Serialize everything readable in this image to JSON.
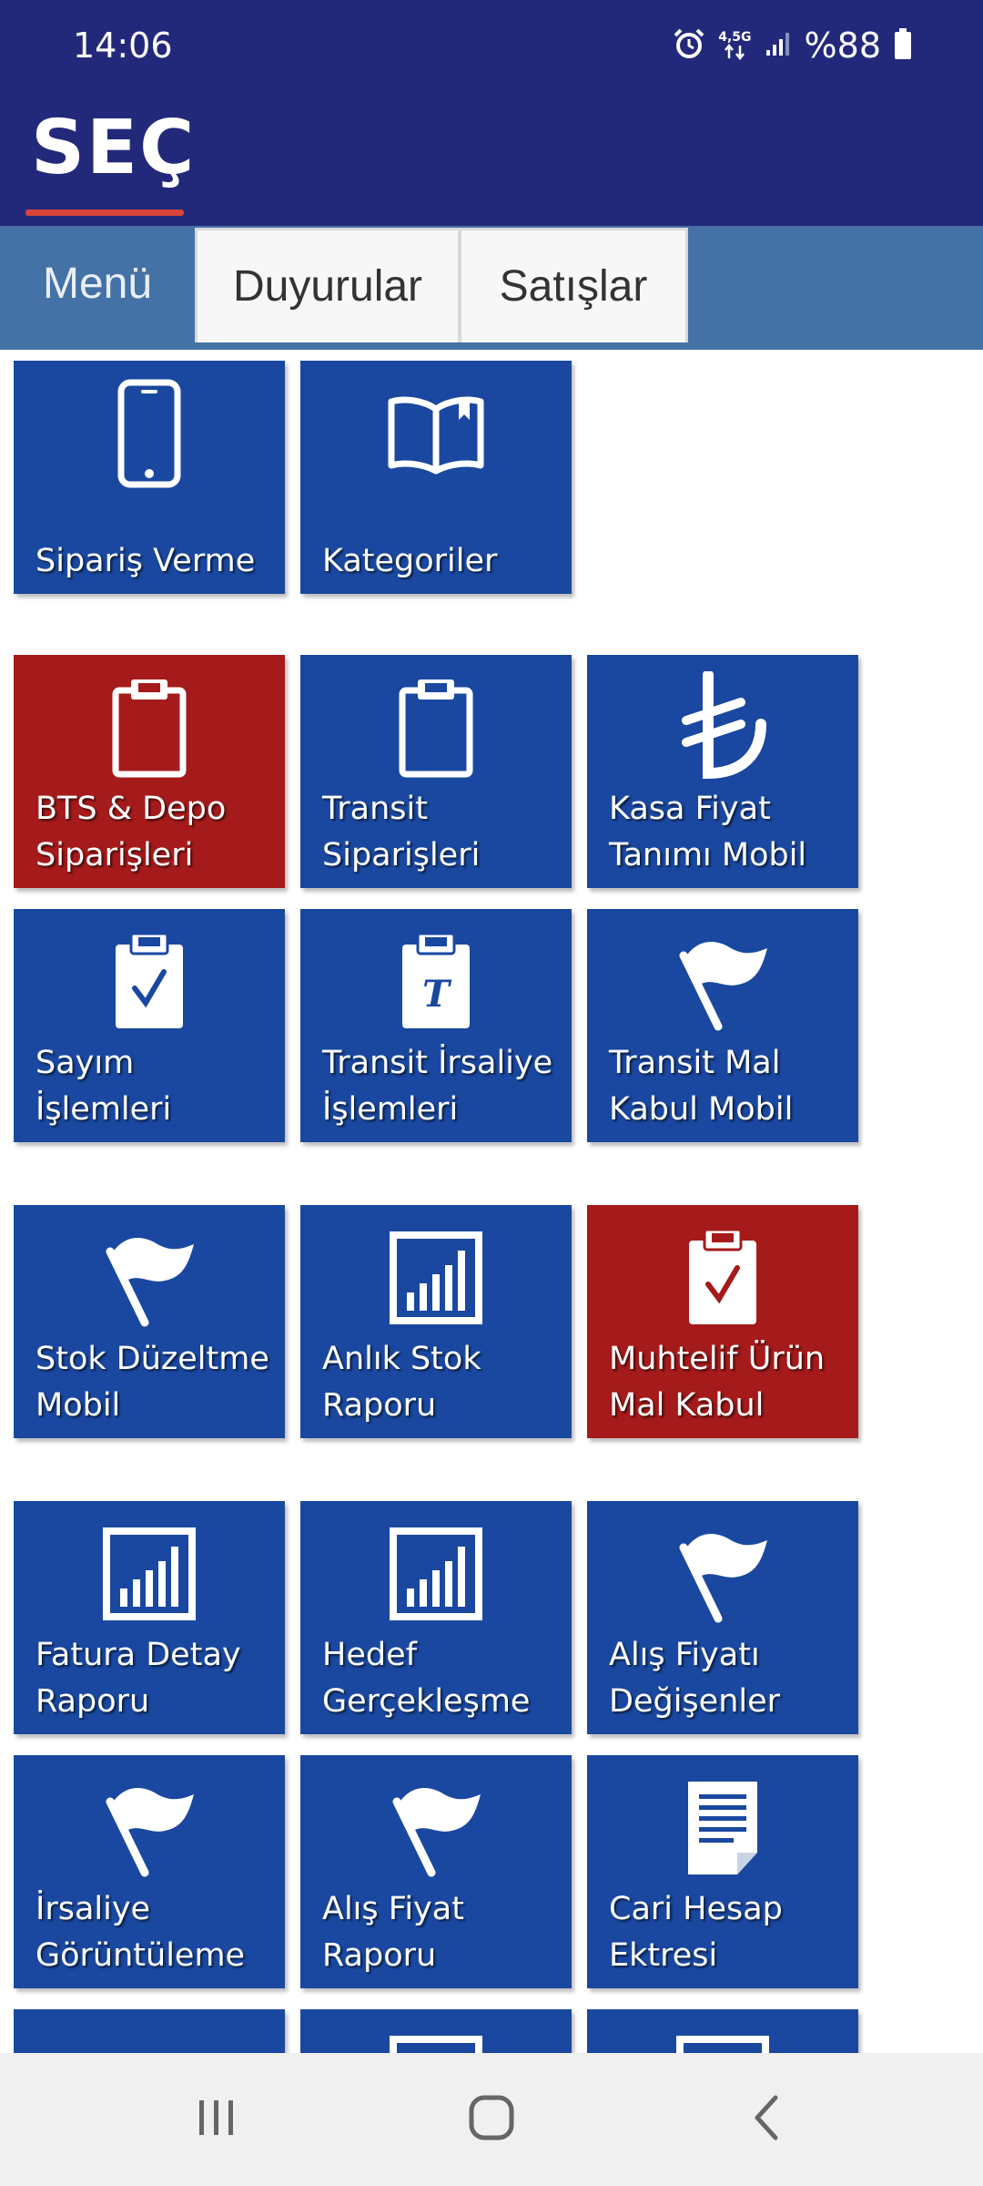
{
  "status_bar": {
    "time": "14:06",
    "network": "4,5G",
    "battery": "%88",
    "icons": [
      "alarm-icon",
      "data-arrows-icon",
      "signal-icon",
      "battery-icon"
    ]
  },
  "header": {
    "logo_text": "SEÇ",
    "background": "#23297a",
    "accent": "#d8443b"
  },
  "tabs": [
    {
      "label": "Menü",
      "active": true
    },
    {
      "label": "Duyurular",
      "active": false
    },
    {
      "label": "Satışlar",
      "active": false
    }
  ],
  "tiles": [
    {
      "label": "Sipariş Verme",
      "icon": "phone-icon",
      "color": "blue"
    },
    {
      "label": "Kategoriler",
      "icon": "book-icon",
      "color": "blue"
    },
    {
      "label": "BTS & Depo\nSiparişleri",
      "icon": "clipboard-icon",
      "color": "red"
    },
    {
      "label": "Transit\nSiparişleri",
      "icon": "clipboard-icon",
      "color": "blue"
    },
    {
      "label": "Kasa Fiyat\nTanımı Mobil",
      "icon": "lira-icon",
      "color": "blue"
    },
    {
      "label": "Sayım İşlemleri",
      "icon": "clipboard-check-icon",
      "color": "blue"
    },
    {
      "label": "Transit İrsaliye\nİşlemleri",
      "icon": "clipboard-t-icon",
      "color": "blue"
    },
    {
      "label": "Transit Mal\nKabul Mobil",
      "icon": "flag-icon",
      "color": "blue"
    },
    {
      "label": "Stok Düzeltme\nMobil",
      "icon": "flag-icon",
      "color": "blue"
    },
    {
      "label": "Anlık Stok\nRaporu",
      "icon": "chart-icon",
      "color": "blue"
    },
    {
      "label": "Muhtelif Ürün\nMal Kabul",
      "icon": "clipboard-check-icon",
      "color": "red"
    },
    {
      "label": "Fatura Detay\nRaporu",
      "icon": "chart-icon",
      "color": "blue"
    },
    {
      "label": "Hedef\nGerçekleşme",
      "icon": "chart-icon",
      "color": "blue"
    },
    {
      "label": "Alış Fiyatı\nDeğişenler",
      "icon": "flag-icon",
      "color": "blue"
    },
    {
      "label": "İrsaliye\nGörüntüleme",
      "icon": "flag-icon",
      "color": "blue"
    },
    {
      "label": "Alış Fiyat\nRaporu",
      "icon": "flag-icon",
      "color": "blue"
    },
    {
      "label": "Cari Hesap\nEktresi",
      "icon": "document-icon",
      "color": "blue"
    },
    {
      "label": "",
      "icon": "",
      "color": "blue"
    },
    {
      "label": "",
      "icon": "chart-icon",
      "color": "blue"
    },
    {
      "label": "",
      "icon": "chart-icon",
      "color": "blue"
    }
  ],
  "nav": {
    "recents": "recents-icon",
    "home": "home-icon",
    "back": "back-icon"
  }
}
